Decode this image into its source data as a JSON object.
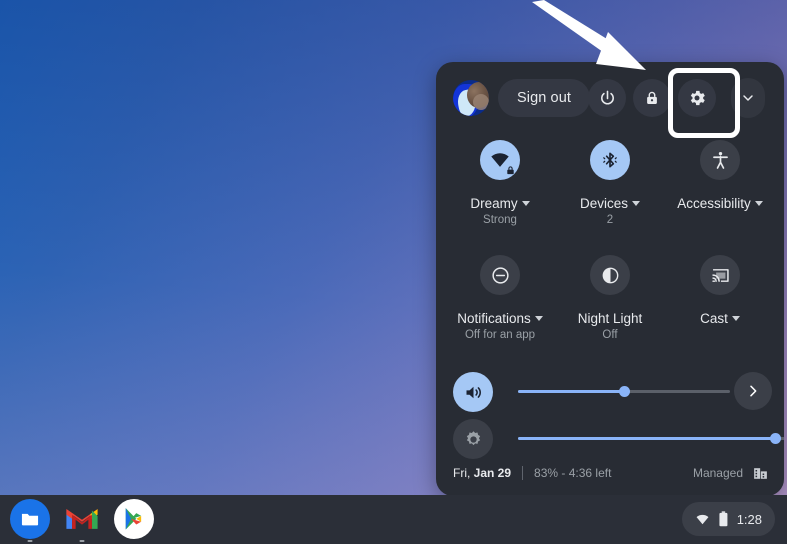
{
  "desktop": {
    "wallpaper_colors": [
      "#1f62b8",
      "#6a74bd",
      "#b192c6"
    ]
  },
  "annotation": {
    "arrow_name": "pointer-arrow",
    "arrow_color": "#ffffff",
    "highlight_target": "settings-button",
    "highlight_color": "#ffffff"
  },
  "quick_settings": {
    "header": {
      "avatar_name": "user-avatar",
      "sign_out_label": "Sign out",
      "power_icon": "power-icon",
      "lock_icon": "lock-icon",
      "settings_icon": "gear-icon",
      "collapse_icon": "chevron-down-icon"
    },
    "tiles": [
      {
        "name": "network",
        "icon": "wifi-locked-icon",
        "label": "Dreamy",
        "sublabel": "Strong",
        "has_caret": true,
        "active": true
      },
      {
        "name": "bluetooth",
        "icon": "bluetooth-icon",
        "label": "Devices",
        "sublabel": "2",
        "has_caret": true,
        "active": true
      },
      {
        "name": "accessibility",
        "icon": "accessibility-icon",
        "label": "Accessibility",
        "sublabel": "",
        "has_caret": true,
        "active": false
      },
      {
        "name": "notifications",
        "icon": "do-not-disturb-icon",
        "label": "Notifications",
        "sublabel": "Off for an app",
        "has_caret": true,
        "active": false
      },
      {
        "name": "night-light",
        "icon": "night-light-icon",
        "label": "Night Light",
        "sublabel": "Off",
        "has_caret": false,
        "active": false
      },
      {
        "name": "cast",
        "icon": "cast-icon",
        "label": "Cast",
        "sublabel": "",
        "has_caret": true,
        "active": false
      }
    ],
    "sliders": {
      "volume": {
        "icon": "volume-up-icon",
        "value": 50,
        "active": true,
        "next_icon": "chevron-right-icon"
      },
      "brightness": {
        "icon": "brightness-icon",
        "value": 96,
        "active": false
      }
    },
    "bottom": {
      "date_prefix": "Fri, ",
      "date": "Jan 29",
      "battery": "83% - 4:36 left",
      "managed_label": "Managed",
      "managed_icon": "enterprise-building-icon"
    }
  },
  "shelf": {
    "apps": [
      {
        "name": "files",
        "label": "Files",
        "icon": "folder-icon"
      },
      {
        "name": "gmail",
        "label": "Gmail",
        "icon": "gmail-m-icon"
      },
      {
        "name": "play-store",
        "label": "Play Store",
        "icon": "play-triangle-icon"
      }
    ],
    "status_tray": {
      "wifi_icon": "wifi-icon",
      "battery_icon": "battery-icon",
      "time": "1:28"
    }
  }
}
